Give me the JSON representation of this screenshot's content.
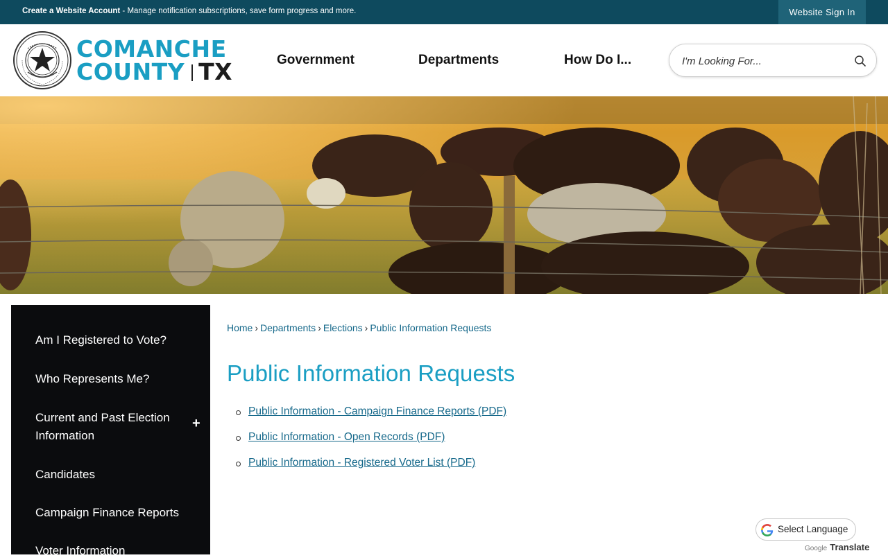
{
  "topbar": {
    "create_account": "Create a Website Account",
    "account_desc": " - Manage notification subscriptions, save form progress and more.",
    "sign_in": "Website Sign In"
  },
  "header": {
    "logo_line1": "COMANCHE",
    "logo_line2": "COUNTY",
    "logo_state": "TX",
    "seal_text": "THE STATE OF TEXAS · COMANCHE COUNTY",
    "nav": [
      "Government",
      "Departments",
      "How Do I..."
    ],
    "search_placeholder": "I'm Looking For..."
  },
  "banner": {
    "alt": "Cattle grazing in a golden field behind a barbed-wire fence"
  },
  "sidebar": {
    "items": [
      "Am I Registered to Vote?",
      "Who Represents Me?",
      "Current and Past Election Information",
      "Candidates",
      "Campaign Finance Reports",
      "Voter Information"
    ],
    "expand_symbol": "+"
  },
  "breadcrumb": [
    "Home",
    "Departments",
    "Elections",
    "Public Information Requests"
  ],
  "main": {
    "title": "Public Information Requests",
    "documents": [
      "Public Information - Campaign Finance Reports (PDF)",
      "Public Information - Open Records (PDF)",
      "Public Information - Registered Voter List (PDF)"
    ]
  },
  "translate": {
    "label": "Select Language",
    "powered_by": "Google",
    "translate": "Translate"
  },
  "colors": {
    "topbar": "#0e4a5e",
    "brand_blue": "#1a9ec3",
    "link": "#15688a",
    "sidebar_bg": "#0b0c0e"
  }
}
